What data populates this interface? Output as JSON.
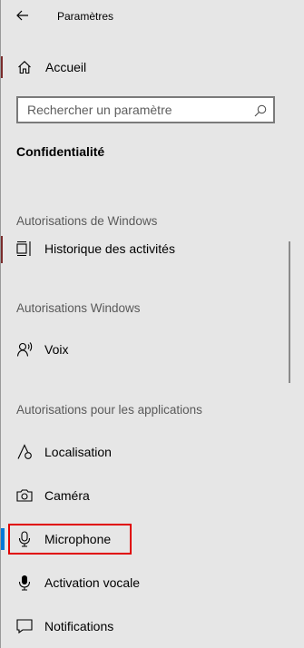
{
  "window": {
    "title": "Paramètres"
  },
  "nav": {
    "home_label": "Accueil",
    "search_placeholder": "Rechercher un paramètre",
    "page_title": "Confidentialité"
  },
  "sections": {
    "windows_permissions": "Autorisations de Windows",
    "windows_permissions_2": "Autorisations Windows",
    "app_permissions": "Autorisations pour les applications"
  },
  "items": {
    "activity_history": "Historique des activités",
    "voice": "Voix",
    "location": "Localisation",
    "camera": "Caméra",
    "microphone": "Microphone",
    "voice_activation": "Activation vocale",
    "notifications": "Notifications"
  },
  "selected_item": "microphone",
  "colors": {
    "background": "#e6e6e6",
    "accent": "#0078d7",
    "highlight": "#e00000"
  }
}
